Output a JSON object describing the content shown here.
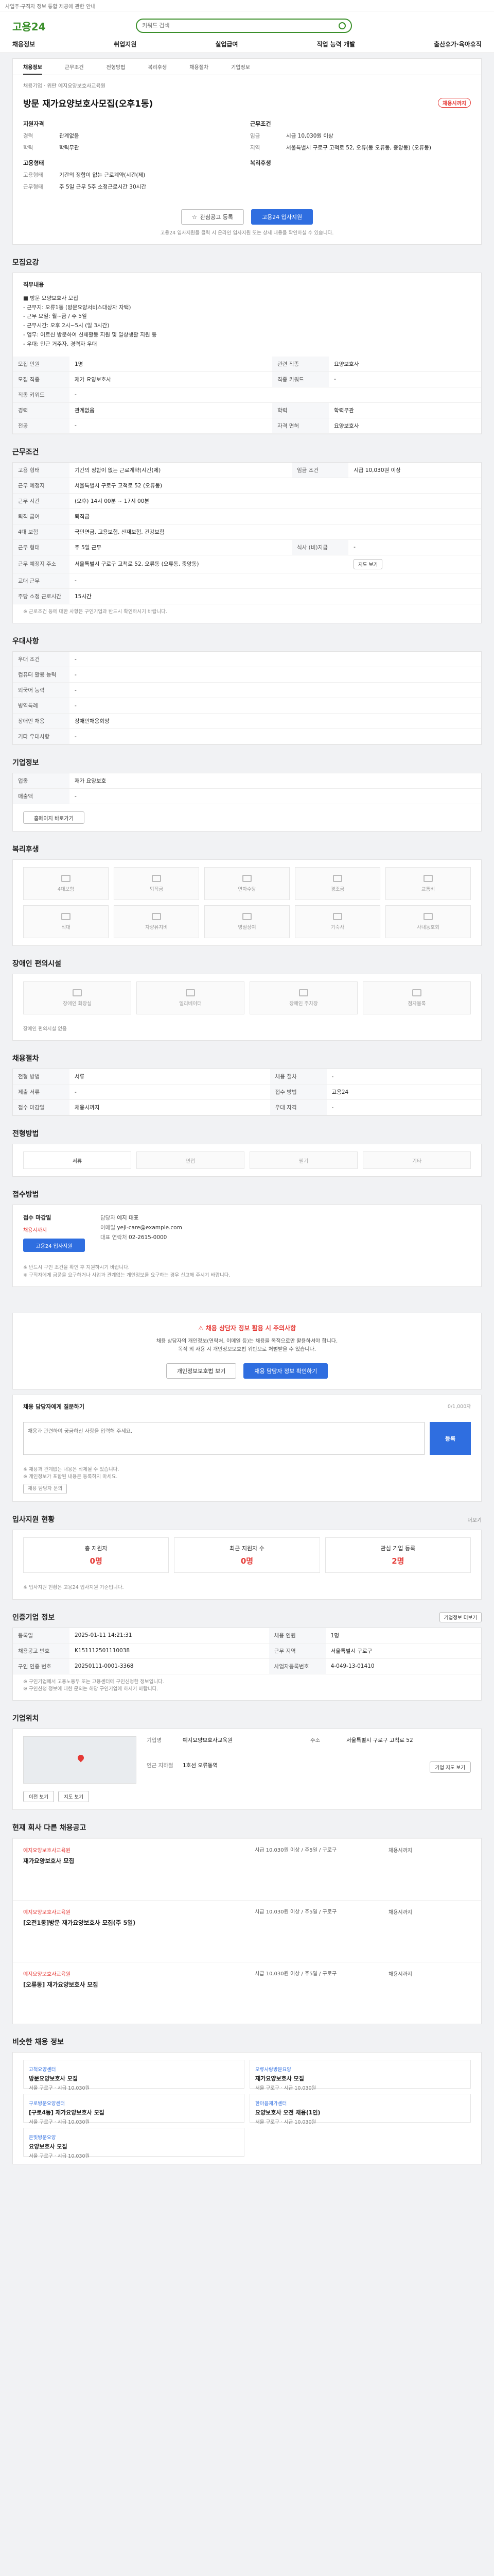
{
  "topbar": {
    "notice": "사업주·구직자 정보 통합 제공에 관한 안내"
  },
  "header": {
    "logo": "고용24",
    "search_placeholder": "키워드 검색",
    "gnb": [
      "채용정보",
      "취업지원",
      "실업급여",
      "직업 능력 개발",
      "출산휴가·육아휴직"
    ]
  },
  "tabs": [
    "채용정보",
    "근무조건",
    "전형방법",
    "복리후생",
    "채용절차",
    "기업정보"
  ],
  "job": {
    "company_label": "채용기업",
    "company": "위판 예지요양보호사교육원",
    "title": "방문 재가요양보호사모집(오후1동)",
    "dday": "채용시까지",
    "left": {
      "heading": "지원자격",
      "rows": [
        {
          "k": "경력",
          "v": "관계없음"
        },
        {
          "k": "학력",
          "v": "학력무관"
        }
      ],
      "heading2": "고용형태",
      "rows2": [
        {
          "k": "고용형태",
          "v": "기간의 정함이 없는 근로계약(시간(제)"
        },
        {
          "k": "근무형태",
          "v": "주 5일 근무 5주 소정근로시간 30시간"
        }
      ]
    },
    "right": {
      "heading": "근무조건",
      "rows": [
        {
          "k": "임금",
          "v": "시급 10,030원 이상"
        },
        {
          "k": "지역",
          "v": "서울특별시 구로구 고척로 52, 오류(동 오류동, 중앙동) (오류동)"
        }
      ],
      "heading2": "복리후생",
      "rows2": [
        {
          "k": "",
          "v": ""
        }
      ]
    },
    "btn_interest": "관심공고 등록",
    "btn_apply": "고용24 입사지원",
    "apply_note": "고용24 입사지원을 클릭 시 온라인 입사지원 또는 상세 내용을 확인하실 수 있습니다."
  },
  "recruit": {
    "title": "모집요강",
    "desc_title": "직무내용",
    "desc": [
      "■ 방문 요양보호사 모집",
      "- 근무지: 오류1동 (방문요양서비스대상자 자택)",
      "- 근무 요일: 월~금 / 주 5일",
      "- 근무시간: 오후 2시~5시 (일 3시간)",
      "- 업무: 어르신 방문하여 신체활동 지원 및 일상생활 지원 등",
      "- 우대: 인근 거주자, 경력자 우대"
    ],
    "rows": [
      {
        "k": "모집 인원",
        "v": "1명",
        "k2": "관련 직종",
        "v2": "요양보호사"
      },
      {
        "k": "모집 직종",
        "v": "재가 요양보호사",
        "k2": "직종 키워드",
        "v2": "-"
      },
      {
        "k": "직종 키워드",
        "v": "-",
        "k2": "",
        "v2": ""
      },
      {
        "k": "경력",
        "v": "관계없음",
        "k2": "학력",
        "v2": "학력무관"
      },
      {
        "k": "전공",
        "v": "-",
        "k2": "자격 면허",
        "v2": "요양보호사"
      }
    ]
  },
  "conditions": {
    "title": "근무조건",
    "rows": [
      {
        "k": "고용 형태",
        "v": "기간의 정함이 없는 근로계약(시간(제)",
        "k2": "임금 조건",
        "v2": "시급 10,030원 이상"
      },
      {
        "k": "근무 예정지",
        "v": "서울특별시 구로구 고척로 52 (오류동)",
        "k2": "",
        "v2": ""
      },
      {
        "k": "근무 시간",
        "v": "(오후) 14시 00분 ~ 17시 00분",
        "k2": "",
        "v2": ""
      },
      {
        "k": "퇴직 급여",
        "v": "퇴직금",
        "k2": "",
        "v2": ""
      },
      {
        "k": "4대 보험",
        "v": "국민연금, 고용보험, 산재보험, 건강보험",
        "k2": "",
        "v2": ""
      },
      {
        "k": "근무 형태",
        "v": "주 5일 근무",
        "k2": "식사 (비)지급",
        "v2": "-"
      },
      {
        "k": "근무 예정지 주소",
        "v": "서울특별시 구로구 고척로 52, 오류동 (오류동, 중앙동)",
        "k2": "",
        "v2": ""
      },
      {
        "k": "교대 근무",
        "v": "-",
        "k2": "",
        "v2": ""
      },
      {
        "k": "주당 소정 근로시간",
        "v": "15시간",
        "k2": "",
        "v2": ""
      }
    ],
    "map_button": "지도 보기",
    "note": "※ 근로조건 등에 대한 사항은 구인기업과 반드시 확인하시기 바랍니다."
  },
  "recruit_more": {
    "title": "우대사항",
    "rows": [
      {
        "k": "우대 조건",
        "v": "-"
      },
      {
        "k": "컴퓨터 활용 능력",
        "v": "-"
      },
      {
        "k": "외국어 능력",
        "v": "-"
      },
      {
        "k": "병역특례",
        "v": "-"
      },
      {
        "k": "장애인 채용",
        "v": "장애인채용희망"
      },
      {
        "k": "기타 우대사항",
        "v": "-"
      }
    ]
  },
  "company_info": {
    "title": "기업정보",
    "rows": [
      {
        "k": "업종",
        "v": "재가 요양보호"
      },
      {
        "k": "매출액",
        "v": "-"
      }
    ],
    "link": "홈페이지 바로가기"
  },
  "welfare": {
    "title": "복리후생",
    "items": [
      "4대보험",
      "퇴직금",
      "연차수당",
      "경조금",
      "교통비",
      "식대",
      "차량유지비",
      "명절상여",
      "기숙사",
      "사내동호회"
    ]
  },
  "disabled": {
    "title": "장애인 편의시설",
    "items": [
      "장애인 화장실",
      "엘리베이터",
      "장애인 주차장",
      "점자블록"
    ],
    "extra": "장애인 편의시설 없음"
  },
  "process": {
    "title": "채용절차",
    "rows": [
      {
        "k": "전형 방법",
        "v": "서류",
        "k2": "채용 절차",
        "v2": "-"
      },
      {
        "k": "제출 서류",
        "v": "-",
        "k2": "접수 방법",
        "v2": "고용24"
      },
      {
        "k": "접수 마감일",
        "v": "채용시까지",
        "k2": "우대 자격",
        "v2": "-"
      }
    ]
  },
  "methods": {
    "title": "전형방법",
    "items": [
      "서류",
      "면접",
      "필기",
      "기타"
    ]
  },
  "contact": {
    "title": "접수방법",
    "person_label": "담당자",
    "person": "예지 대표",
    "deadline_label": "접수 마감일",
    "deadline": "채용시까지",
    "email_label": "이메일",
    "email": "yeji-care@example.com",
    "phone_label": "대표 연락처",
    "phone": "02-2615-0000",
    "apply": "고용24 입사지원",
    "notes": [
      "※ 반드시 구인 조건을 확인 후 지원하시기 바랍니다.",
      "※ 구직자에게 금품을 요구하거나 사업과 관계없는 개인정보를 요구하는 경우 신고해 주시기 바랍니다."
    ]
  },
  "warning": {
    "title": "채용 상담자 정보 활용 시 주의사항",
    "lines": [
      "채용 상담자의 개인정보(연락처, 이메일 등)는 채용을 목적으로만 활용하셔야 합니다.",
      "목적 외 사용 시 개인정보보호법 위반으로 처벌받을 수 있습니다."
    ],
    "btn1": "개인정보보호법 보기",
    "btn2": "채용 담당자 정보 확인하기"
  },
  "qa": {
    "title": "채용 담당자에게 질문하기",
    "counter": "0/1,000자",
    "placeholder": "채용과 관련하여 궁금하신 사항을 입력해 주세요.",
    "send": "등록",
    "notes": [
      "※ 채용과 관계없는 내용은 삭제될 수 있습니다.",
      "※ 개인정보가 포함된 내용은 등록하지 마세요."
    ],
    "more": "채용 담당자 문의"
  },
  "apply_stats": {
    "title": "입사지원 현황",
    "more": "더보기",
    "items": [
      {
        "label": "총 지원자",
        "value": "0명"
      },
      {
        "label": "최근 지원자 수",
        "value": "0명"
      },
      {
        "label": "관심 기업 등록",
        "value": "2명"
      }
    ],
    "note": "※ 입사지원 현황은 고용24 입사지원 기준입니다."
  },
  "info_table": {
    "title": "인증기업 정보",
    "more": "기업정보 더보기",
    "rows": [
      {
        "k": "등록일",
        "v": "2025-01-11 14:21:31",
        "k2": "채용 인원",
        "v2": "1명"
      },
      {
        "k": "채용공고 번호",
        "v": "K151112501110038",
        "k2": "근무 지역",
        "v2": "서울특별시 구로구"
      },
      {
        "k": "구인 인증 번호",
        "v": "20250111-0001-3368",
        "k2": "사업자등록번호",
        "v2": "4-049-13-01410"
      }
    ],
    "notes": [
      "※ 구인기업에서 고용노동부 또는 고용센터에 구인신청한 정보입니다.",
      "※ 구인신청 정보에 대한 문의는 해당 구인기업에 하시기 바랍니다."
    ]
  },
  "location": {
    "title": "기업위치",
    "company_label": "기업명",
    "company": "예지요양보호사교육원",
    "addr_label": "주소",
    "addr": "서울특별시 구로구 고척로 52",
    "station_label": "인근 지하철",
    "station": "1호선 오류동역",
    "btn_prev": "이전 보기",
    "btn_map": "지도 보기",
    "btn_next": "기업 지도 보기"
  },
  "related_jobs": {
    "title": "현재 회사 다른 채용공고",
    "items": [
      {
        "company": "예지요양보호사교육원",
        "title": "재가요양보호사 모집",
        "detail": "시급 10,030원 이상 / 주5일 / 구로구",
        "deadline": "채용시까지"
      },
      {
        "company": "예지요양보호사교육원",
        "title": "[오전1동]방문 재가요양보호사 모집(주 5일)",
        "detail": "시급 10,030원 이상 / 주5일 / 구로구",
        "deadline": "채용시까지"
      },
      {
        "company": "예지요양보호사교육원",
        "title": "[오류동] 재가요양보호사 모집",
        "detail": "시급 10,030원 이상 / 주5일 / 구로구",
        "deadline": "채용시까지"
      }
    ]
  },
  "similar": {
    "title": "비슷한 채용 정보",
    "items": [
      {
        "company": "고척요양센터",
        "title": "방문요양보호사 모집",
        "detail": "서울 구로구 · 시급 10,030원"
      },
      {
        "company": "오류사랑방문요양",
        "title": "재가요양보호사 모집",
        "detail": "서울 구로구 · 시급 10,030원"
      },
      {
        "company": "구로방문요양센터",
        "title": "[구로4동] 재가요양보호사 모집",
        "detail": "서울 구로구 · 시급 10,030원"
      },
      {
        "company": "한마음재가센터",
        "title": "요양보호사 오전 채용(1인)",
        "detail": "서울 구로구 · 시급 10,030원"
      },
      {
        "company": "은빛방문요양",
        "title": "요양보호사 모집",
        "detail": "서울 구로구 · 시급 10,030원"
      }
    ]
  }
}
